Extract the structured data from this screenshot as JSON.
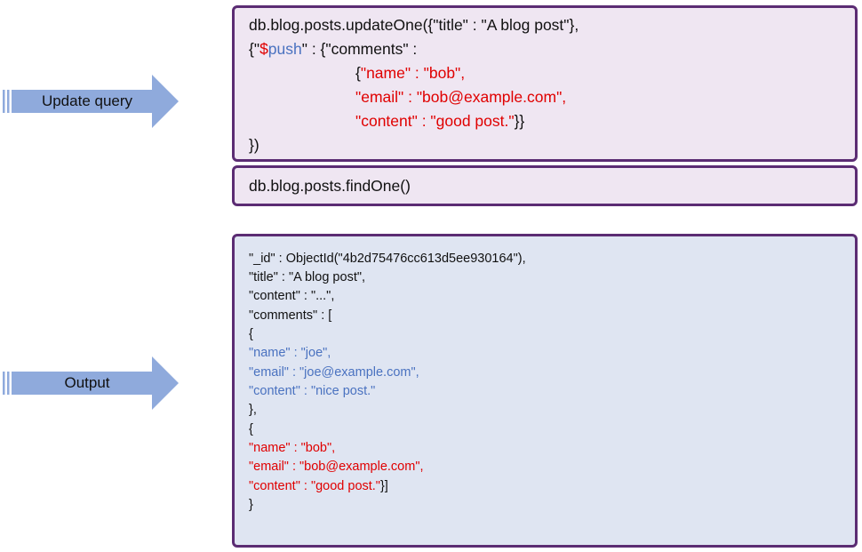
{
  "arrows": {
    "update_label": "Update query",
    "output_label": "Output",
    "fill_color": "#8faadc",
    "stripe_color": "#8faadc"
  },
  "colors": {
    "box_border": "#5b2c73",
    "query_box_bg": "#efe6f2",
    "output_box_bg": "#dfe5f2",
    "highlight_red": "#e00000",
    "highlight_blue": "#4a72c0"
  },
  "update_query": {
    "line1": "db.blog.posts.updateOne({\"title\" : \"A blog post\"},",
    "line2_pre": "{\"",
    "line2_dollar": "$",
    "line2_push": "push",
    "line2_post": "\" : {\"comments\" :",
    "line3_brace": "{",
    "line3": "\"name\" : \"bob\",",
    "line4": "\"email\" : \"bob@example.com\",",
    "line5": "\"content\" : \"good post.\"",
    "line5_close": "}}",
    "line6": "})"
  },
  "find_query": {
    "text": "db.blog.posts.findOne()"
  },
  "output": {
    "id_line": "\"_id\" : ObjectId(\"4b2d75476cc613d5ee930164\"),",
    "title_line": "\"title\" : \"A blog post\",",
    "content_line": "\"content\" : \"...\",",
    "comments_line": "\"comments\" : [",
    "open_brace_1": "{",
    "joe_name": "\"name\" : \"joe\",",
    "joe_email": "\"email\" : \"joe@example.com\",",
    "joe_content": "\"content\" : \"nice post.\"",
    "close_brace_1": "},",
    "open_brace_2": "{",
    "bob_name": "\"name\" : \"bob\",",
    "bob_email": "\"email\" : \"bob@example.com\",",
    "bob_content": "\"content\" : \"good post.\"",
    "bob_close": "}]",
    "close_brace_final": "}"
  }
}
